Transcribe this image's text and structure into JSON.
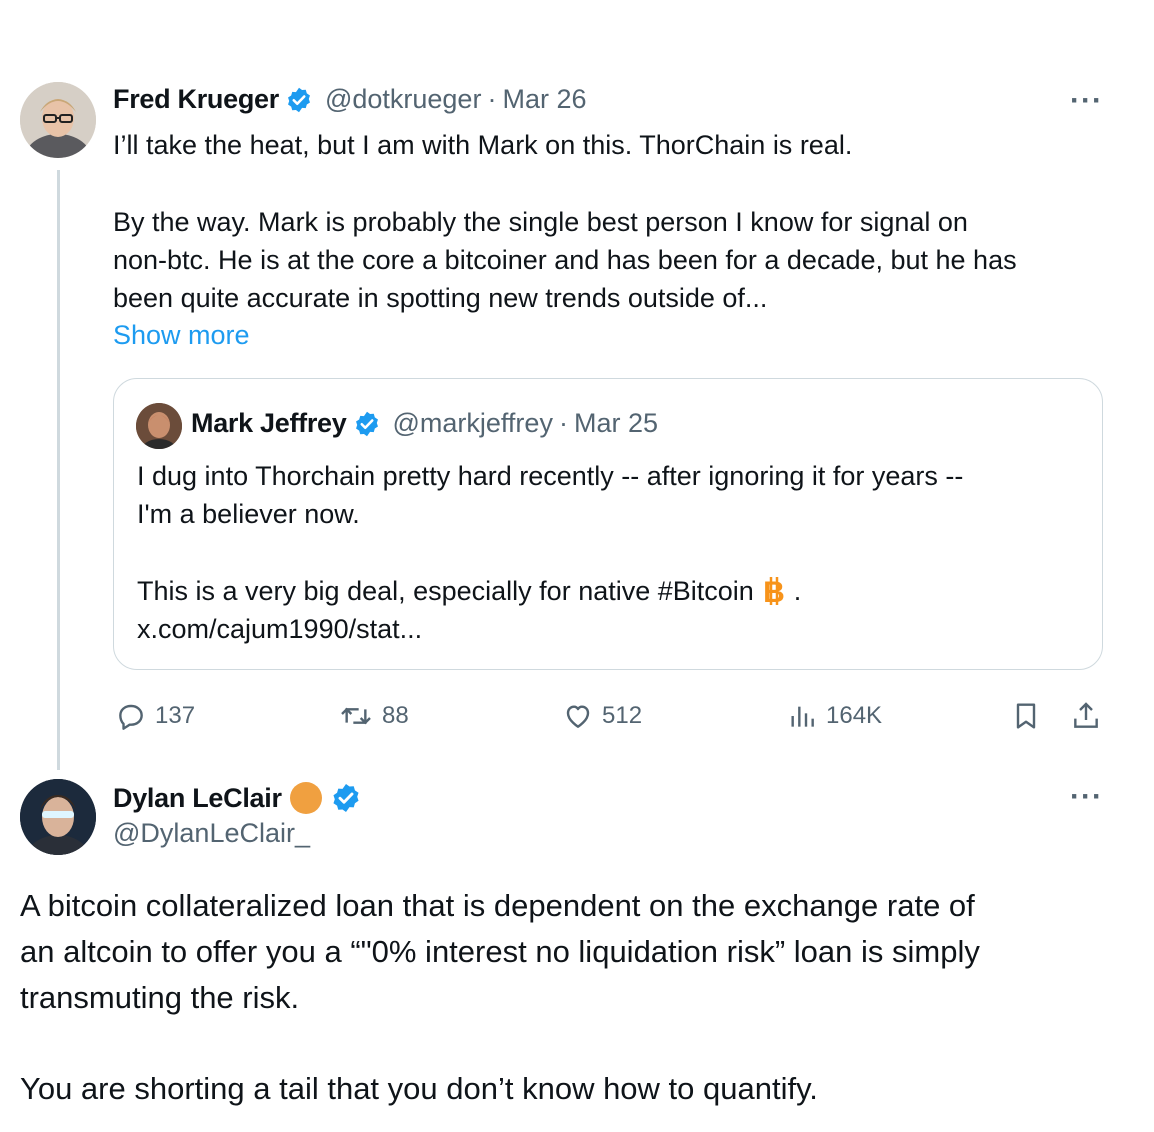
{
  "parent_tweet": {
    "name": "Fred Krueger",
    "handle": "@dotkrueger",
    "date": "Mar 26",
    "separator": "·",
    "text_line1": "I’ll take the heat, but I am with Mark on this. ThorChain is real.",
    "text_para2_line1": "By the way. Mark is probably the single best person I know for signal on",
    "text_para2_line2": "non-btc. He is at the core a bitcoiner and has been for a decade, but he has",
    "text_para2_line3": "been quite accurate in spotting new trends outside of...",
    "show_more": "Show more",
    "more_menu": "···",
    "quoted": {
      "name": "Mark Jeffrey",
      "handle": "@markjeffrey",
      "separator": "·",
      "date": "Mar 25",
      "line1": "I dug into Thorchain pretty hard recently -- after ignoring it for years --",
      "line2": "I'm a believer now.",
      "line3_prefix": "This is a very big deal, especially for native #Bitcoin",
      "line3_suffix": ".",
      "link": "x.com/cajum1990/stat..."
    },
    "actions": {
      "replies": "137",
      "reposts": "88",
      "likes": "512",
      "views": "164K"
    }
  },
  "reply_tweet": {
    "name": "Dylan LeClair",
    "handle": "@DylanLeClair_",
    "more_menu": "···",
    "line1": "A bitcoin collateralized loan that is dependent on the exchange rate of",
    "line2": "an altcoin to offer you a “\"0% interest no liquidation risk” loan is simply",
    "line3": "transmuting the risk.",
    "line4": "You are shorting a tail that you don’t know how to quantify."
  },
  "colors": {
    "verified": "#1d9bf0",
    "link": "#1d9bf0",
    "muted": "#536471",
    "orange_badge": "#f0a040",
    "bitcoin": "#f7931a"
  },
  "icons": [
    "reply-icon",
    "repost-icon",
    "like-icon",
    "views-icon",
    "bookmark-icon",
    "share-icon",
    "verified-badge-icon",
    "bitcoin-icon"
  ]
}
